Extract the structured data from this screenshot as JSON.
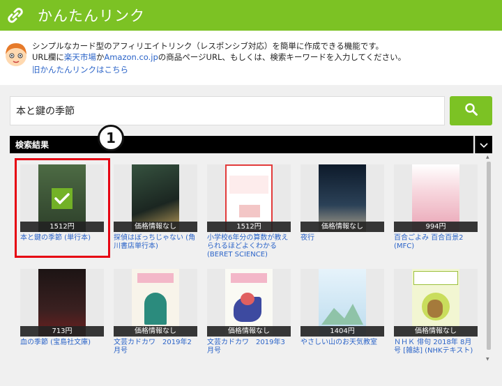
{
  "header": {
    "title": "かんたんリンク",
    "icon": "link-icon"
  },
  "intro": {
    "line1": "シンプルなカード型のアフィリエイトリンク（レスポンシブ対応）を簡単に作成できる機能です。",
    "line2_a": "URL欄に",
    "line2_rakuten": "楽天市場",
    "line2_b": "か",
    "line2_amazon": "Amazon.co.jp",
    "line2_c": "の商品ページURL、もしくは、検索キーワードを入力してください。",
    "old_link": "旧かんたんリンクはこちら"
  },
  "search": {
    "value": "本と鍵の季節",
    "button_icon": "search-icon"
  },
  "results": {
    "label": "検索結果",
    "toggle_icon": "chevron-down-icon"
  },
  "annotation": {
    "number": "1"
  },
  "items": [
    {
      "title": "本と鍵の季節 (単行本)",
      "price": "1512円",
      "cover_color": "#3a5f3a",
      "cover_text": "本と鍵の季節"
    },
    {
      "title": "探偵はぼっちじゃない (角川書店単行本)",
      "price": "価格情報なし",
      "cover_color": "#1e2a24",
      "cover_text": "探偵はぼっちじゃない"
    },
    {
      "title": "小学校6年分の算数が教えられるほどよくわかる (BERET SCIENCE)",
      "price": "1512円",
      "cover_color": "#ffffff",
      "cover_text": "小学校6年分の算数が教えられるほどよくわかる"
    },
    {
      "title": "夜行",
      "price": "価格情報なし",
      "cover_color": "#22303f",
      "cover_text": "夜行"
    },
    {
      "title": "百合ごよみ 百合百景2 (MFC)",
      "price": "994円",
      "cover_color": "#f4d4dc",
      "cover_text": "百合ごよみ"
    },
    {
      "title": "血の季節 (宝島社文庫)",
      "price": "713円",
      "cover_color": "#241414",
      "cover_text": "血の季節"
    },
    {
      "title": "文芸カドカワ　2019年2月号",
      "price": "価格情報なし",
      "cover_color": "#f7f2e8",
      "cover_text": "文芸カドカワ"
    },
    {
      "title": "文芸カドカワ　2019年3月号",
      "price": "価格情報なし",
      "cover_color": "#f6f6f0",
      "cover_text": "文芸カドカワ"
    },
    {
      "title": "やさしい山のお天気教室",
      "price": "1404円",
      "cover_color": "#d9edf8",
      "cover_text": "やさしい山のお天気教室"
    },
    {
      "title": "ＮＨＫ 俳句 2018年 8月号 [雑誌] (NHKテキスト)",
      "price": "価格情報なし",
      "cover_color": "#f2f6cf",
      "cover_text": "NHK俳句"
    }
  ],
  "colors": {
    "brand_green": "#7cc224",
    "link_blue": "#2a63c8",
    "highlight_red": "#e60012"
  }
}
